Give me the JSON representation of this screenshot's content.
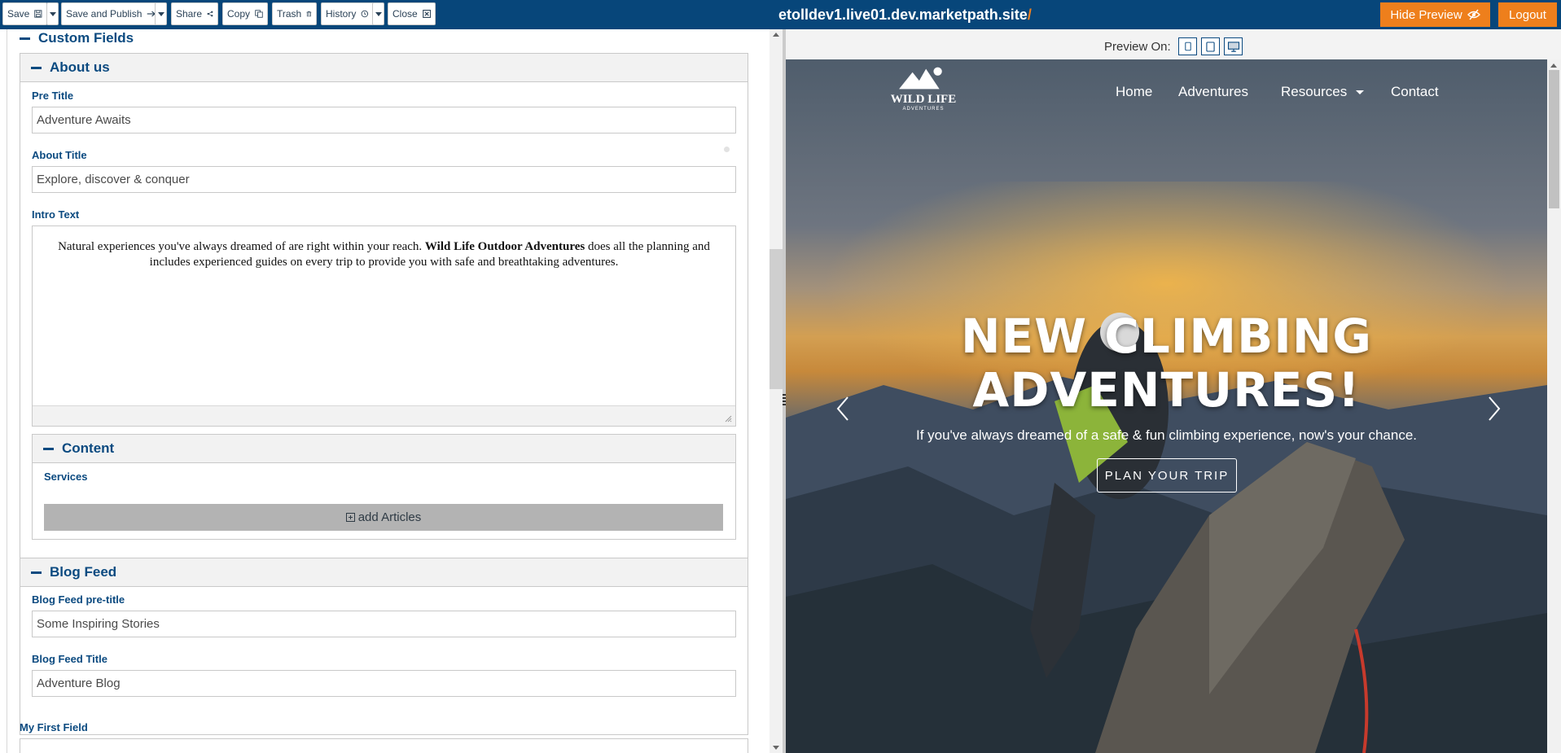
{
  "toolbar": {
    "save_label": "Save",
    "save_publish_label": "Save and Publish",
    "share_label": "Share",
    "copy_label": "Copy",
    "trash_label": "Trash",
    "history_label": "History",
    "close_label": "Close",
    "site_url": "etolldev1.live01.dev.marketpath.site",
    "site_url_slash": "/",
    "hide_preview_label": "Hide Preview",
    "logout_label": "Logout"
  },
  "editor": {
    "custom_fields_title": "Custom Fields",
    "about_us": {
      "title": "About us",
      "pre_title_label": "Pre Title",
      "pre_title_value": "Adventure Awaits",
      "about_title_label": "About Title",
      "about_title_value": "Explore, discover & conquer",
      "intro_text_label": "Intro Text",
      "intro_text_before": "Natural experiences you've always dreamed of are right within your reach. ",
      "intro_text_bold": "Wild Life Outdoor Adventures",
      "intro_text_after": " does all the planning and includes experienced guides on every trip to provide you with safe and breathtaking adventures."
    },
    "content": {
      "title": "Content",
      "services_label": "Services",
      "add_articles_label": "add Articles"
    },
    "blog_feed": {
      "title": "Blog Feed",
      "pretitle_label": "Blog Feed pre-title",
      "pretitle_value": "Some Inspiring Stories",
      "title_label": "Blog Feed Title",
      "title_value": "Adventure Blog"
    },
    "my_first_field_label": "My First Field"
  },
  "preview": {
    "preview_on_label": "Preview On:",
    "logo_line1": "WILD LIFE",
    "logo_line2": "ADVENTURES",
    "nav": [
      "Home",
      "Adventures",
      "Resources",
      "Contact"
    ],
    "hero_title_line1": "NEW CLIMBING",
    "hero_title_line2": "ADVENTURES!",
    "hero_subtitle": "If you've always dreamed of a safe & fun climbing experience, now's your chance.",
    "cta_label": "PLAN YOUR TRIP"
  },
  "colors": {
    "topbar": "#07467a",
    "accent_orange": "#ee7f1c",
    "label_blue": "#0b4a80"
  }
}
